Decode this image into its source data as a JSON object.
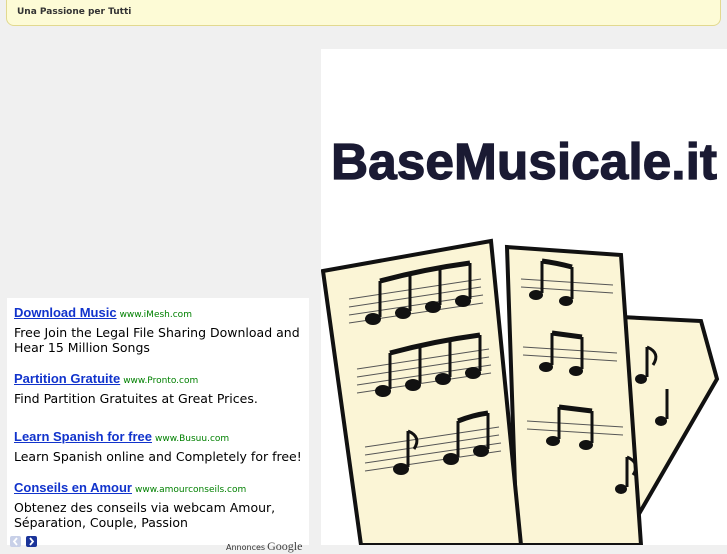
{
  "banner": {
    "slogan": "Una Passione per Tutti"
  },
  "logo": {
    "text": "BaseMusicale.it"
  },
  "ads": [
    {
      "title": "Download Music",
      "url": "www.iMesh.com",
      "description": "Free Join the Legal File Sharing Download and Hear 15 Million Songs"
    },
    {
      "title": "Partition Gratuite",
      "url": "www.Pronto.com",
      "description": "Find Partition Gratuites at Great Prices."
    },
    {
      "title": "Learn Spanish for free",
      "url": "www.Busuu.com",
      "description": "Learn Spanish online and Completely for free!"
    },
    {
      "title": "Conseils en Amour",
      "url": "www.amourconseils.com",
      "description": "Obtenez des conseils via webcam Amour, Séparation, Couple, Passion"
    }
  ],
  "ads_footer": {
    "annonces": "Annonces",
    "google": "Google"
  },
  "icons": {
    "prev": "chevron-left-icon",
    "next": "chevron-right-icon"
  },
  "colors": {
    "ad_title": "#1133cc",
    "ad_url": "#008000",
    "banner_bg": "#fdfbd6",
    "nav_active": "#1a3399"
  }
}
